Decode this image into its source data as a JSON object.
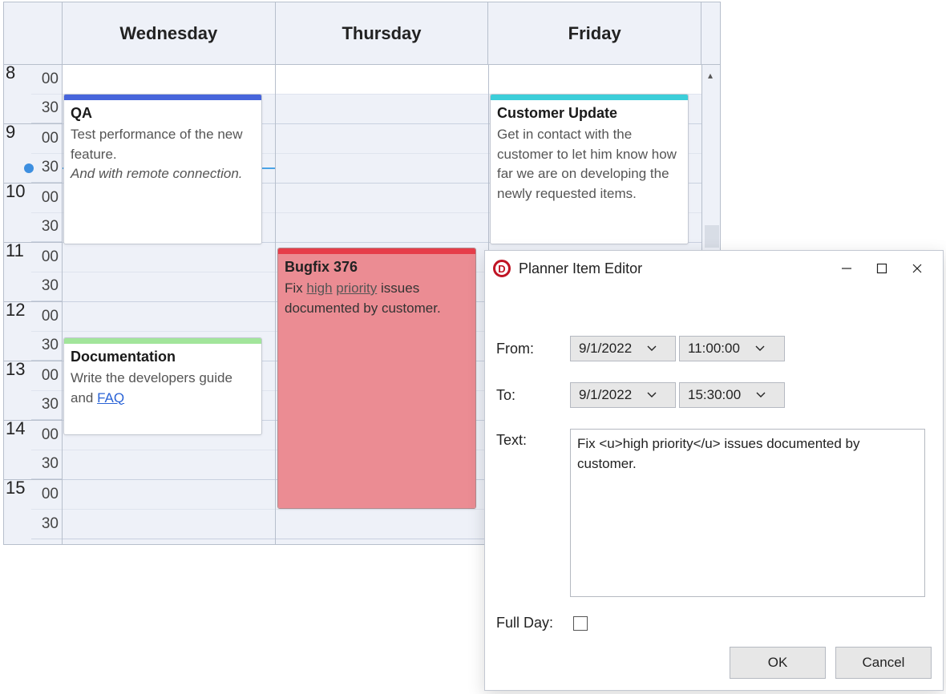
{
  "calendar": {
    "days": [
      "Wednesday",
      "Thursday",
      "Friday"
    ],
    "hours": [
      "8",
      "9",
      "10",
      "11",
      "12",
      "13",
      "14",
      "15"
    ],
    "minute_labels": [
      "00",
      "30"
    ]
  },
  "events": {
    "qa": {
      "title": "QA",
      "desc": "Test performance of the new feature.",
      "note": "And with remote connection."
    },
    "cust": {
      "title": "Customer Update",
      "desc": "Get in contact with the customer to let him know how far we are on developing the newly requested items."
    },
    "bug": {
      "title": "Bugfix 376",
      "desc_pre": "Fix ",
      "desc_u1": "high",
      "desc_sp": " ",
      "desc_u2": "priority",
      "desc_post": " issues documented by customer."
    },
    "doc": {
      "title": "Documentation",
      "desc_pre": "Write the developers guide and ",
      "faq": "FAQ"
    }
  },
  "dialog": {
    "title": "Planner Item Editor",
    "from_label": "From:",
    "to_label": "To:",
    "text_label": "Text:",
    "fullday_label": "Full Day:",
    "from_date": "9/1/2022",
    "from_time": "11:00:00",
    "to_date": "9/1/2022",
    "to_time": "15:30:00",
    "text_value": "Fix <u>high priority</u> issues documented by customer.",
    "ok": "OK",
    "cancel": "Cancel"
  }
}
